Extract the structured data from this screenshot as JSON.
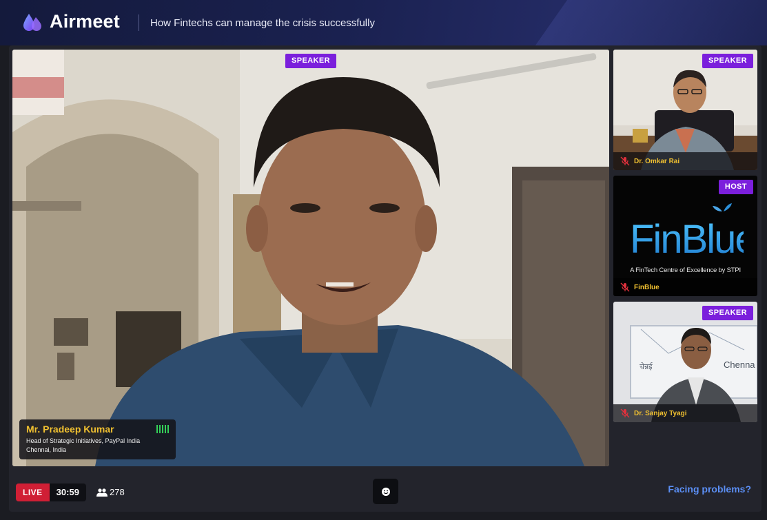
{
  "header": {
    "brand": "Airmeet",
    "event_title": "How Fintechs can manage the crisis successfully"
  },
  "main_tile": {
    "role": "SPEAKER",
    "name": "Mr. Pradeep Kumar",
    "designation": "Head of Strategic Initiatives, PayPal India",
    "location": "Chennai, India",
    "audio_icon": "audio-level-icon"
  },
  "side_tiles": [
    {
      "role": "SPEAKER",
      "name": "Dr. Omkar Rai",
      "mic_icon": "mic-muted-icon"
    },
    {
      "role": "HOST",
      "name": "FinBlue",
      "mic_icon": "mic-muted-icon",
      "logo_text": "FinBlue",
      "tagline": "A FinTech Centre of Excellence by STPI"
    },
    {
      "role": "SPEAKER",
      "name": "Dr. Sanjay Tyagi",
      "mic_icon": "mic-muted-icon",
      "banner_hindi": "चेन्नई",
      "banner_text": "Chenna"
    }
  ],
  "bottom_bar": {
    "live_label": "LIVE",
    "timer": "30:59",
    "attendee_count": "278",
    "attendee_icon": "people-icon",
    "reaction_icon": "smiley-icon",
    "help_link": "Facing problems?"
  },
  "colors": {
    "role_badge": "#7b1fdc",
    "live": "#d01f35",
    "name_highlight": "#f0c030",
    "help_link": "#5b8ff5",
    "finblue": "#2ea6e8"
  }
}
